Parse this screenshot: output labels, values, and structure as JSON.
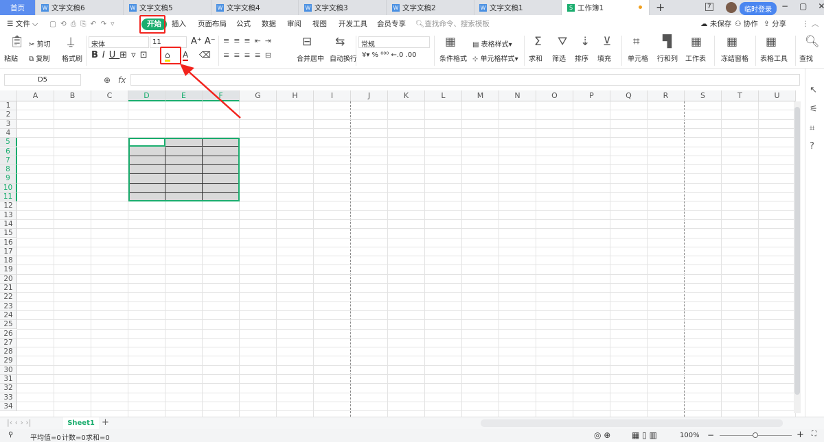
{
  "tabs": {
    "home": "首页",
    "docs": [
      {
        "label": "文字文稿6",
        "icon": "W"
      },
      {
        "label": "文字文稿5",
        "icon": "W"
      },
      {
        "label": "文字文稿4",
        "icon": "W"
      },
      {
        "label": "文字文稿3",
        "icon": "W"
      },
      {
        "label": "文字文稿2",
        "icon": "W"
      },
      {
        "label": "文字文稿1",
        "icon": "W"
      }
    ],
    "active": {
      "label": "工作簿1",
      "icon": "S"
    },
    "new_tab": "+",
    "login": "临时登录",
    "badge": "7"
  },
  "menu": {
    "file": "文件",
    "items": [
      "开始",
      "插入",
      "页面布局",
      "公式",
      "数据",
      "审阅",
      "视图",
      "开发工具",
      "会员专享"
    ],
    "search": "查找命令、搜索模板",
    "unsaved": "未保存",
    "collab": "协作",
    "share": "分享"
  },
  "ribbon": {
    "paste": "粘贴",
    "cut": "剪切",
    "copy": "复制",
    "format_painter": "格式刷",
    "font": "宋体",
    "size": "11",
    "merge": "合并居中",
    "wrap": "自动换行",
    "number_format": "常规",
    "cond_format": "条件格式",
    "table_style": "表格样式",
    "cell_style": "单元格样式",
    "sum": "求和",
    "filter": "筛选",
    "sort": "排序",
    "fill": "填充",
    "cell": "单元格",
    "rowcol": "行和列",
    "sheet": "工作表",
    "freeze": "冻结窗格",
    "table_tools": "表格工具",
    "find": "查找",
    "accent": "#1aad6e",
    "fill_color": "#f5e400",
    "font_color": "#e00000"
  },
  "formula": {
    "cell_ref": "D5",
    "fx": "fx",
    "value": ""
  },
  "grid": {
    "columns": [
      "A",
      "B",
      "C",
      "D",
      "E",
      "F",
      "G",
      "H",
      "I",
      "J",
      "K",
      "L",
      "M",
      "N",
      "O",
      "P",
      "Q",
      "R",
      "S",
      "T",
      "U"
    ],
    "rows": 34,
    "selection": "D5:F11"
  },
  "sheets": {
    "tabs": [
      "Sheet1"
    ],
    "add": "+"
  },
  "status": {
    "avg": "平均值=0",
    "count": "计数=0",
    "sum": "求和=0",
    "zoom": "100%"
  }
}
